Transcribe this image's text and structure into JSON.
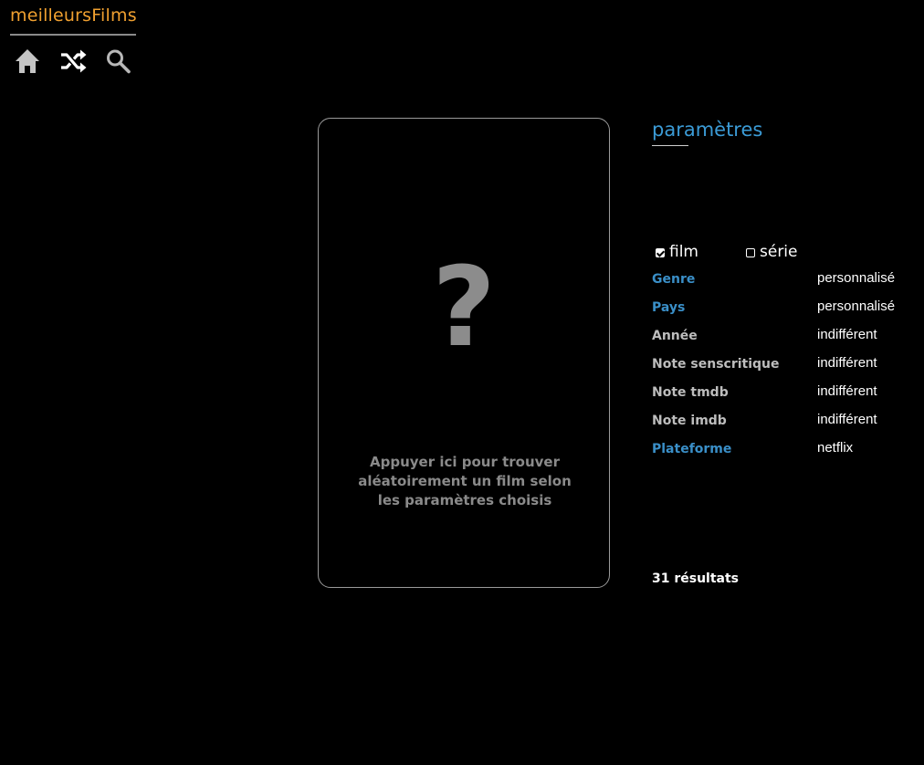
{
  "app": {
    "logo": "meilleursFilms"
  },
  "nav": {
    "home_icon": "home-icon",
    "shuffle_icon": "shuffle-icon",
    "search_icon": "search-icon"
  },
  "card": {
    "mark": "?",
    "text": "Appuyer ici pour trouver aléatoirement un film selon les paramètres choisis"
  },
  "params": {
    "title": "paramètres",
    "types": [
      {
        "label": "film",
        "checked": true
      },
      {
        "label": "série",
        "checked": false
      }
    ],
    "rows": [
      {
        "label": "Genre",
        "value": "personnalisé",
        "style": "link"
      },
      {
        "label": "Pays",
        "value": "personnalisé",
        "style": "link"
      },
      {
        "label": "Année",
        "value": "indifférent",
        "style": "plain"
      },
      {
        "label": "Note senscritique",
        "value": "indifférent",
        "style": "plain"
      },
      {
        "label": "Note tmdb",
        "value": "indifférent",
        "style": "plain"
      },
      {
        "label": "Note imdb",
        "value": "indifférent",
        "style": "plain"
      },
      {
        "label": "Plateforme",
        "value": "netflix",
        "style": "link"
      }
    ],
    "results": "31 résultats"
  },
  "colors": {
    "background": "#000000",
    "logo": "#f0a030",
    "accent": "#3b9bd6",
    "link": "#3a8fc8",
    "muted": "#8c8c8c"
  }
}
